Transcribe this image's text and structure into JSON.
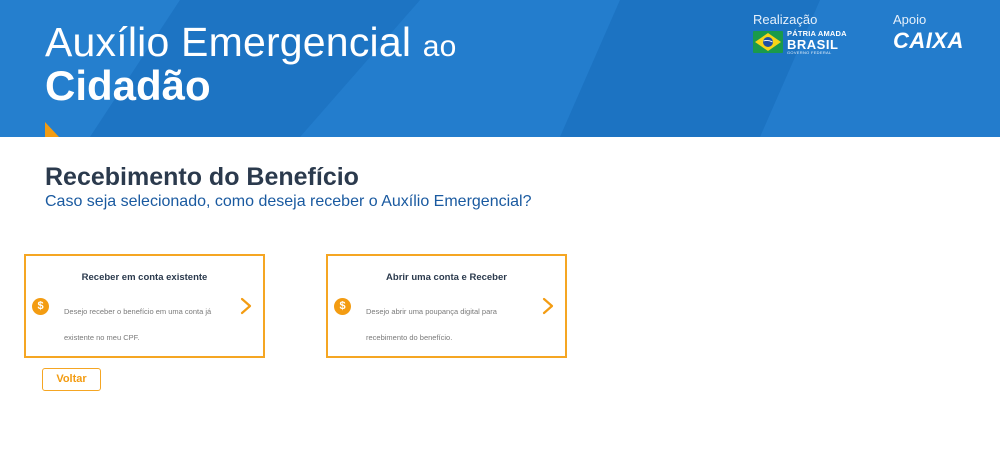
{
  "banner": {
    "title_line1": "Auxílio Emergencial",
    "title_line1_suffix": "ao",
    "title_line2": "Cidadão",
    "background_color": "#1f78c8",
    "accent_color": "#f39c12"
  },
  "sponsors": {
    "realizacao_label": "Realização",
    "brasil_logo": {
      "line1": "PÁTRIA AMADA",
      "line2": "BRASIL",
      "line3": "GOVERNO FEDERAL",
      "icon": "brazil-flag-icon"
    },
    "apoio_label": "Apoio",
    "caixa_logo": "CAIXA"
  },
  "page": {
    "title": "Recebimento do Benefício",
    "subtitle": "Caso seja selecionado, como deseja receber o Auxílio Emergencial?"
  },
  "options": [
    {
      "title": "Receber em conta existente",
      "description": "Desejo receber o benefício em uma conta já existente no meu CPF.",
      "icon": "dollar-coin-icon"
    },
    {
      "title": "Abrir uma conta e Receber",
      "description": "Desejo abrir uma poupança digital para recebimento do benefício.",
      "icon": "dollar-coin-icon"
    }
  ],
  "actions": {
    "back_label": "Voltar"
  }
}
